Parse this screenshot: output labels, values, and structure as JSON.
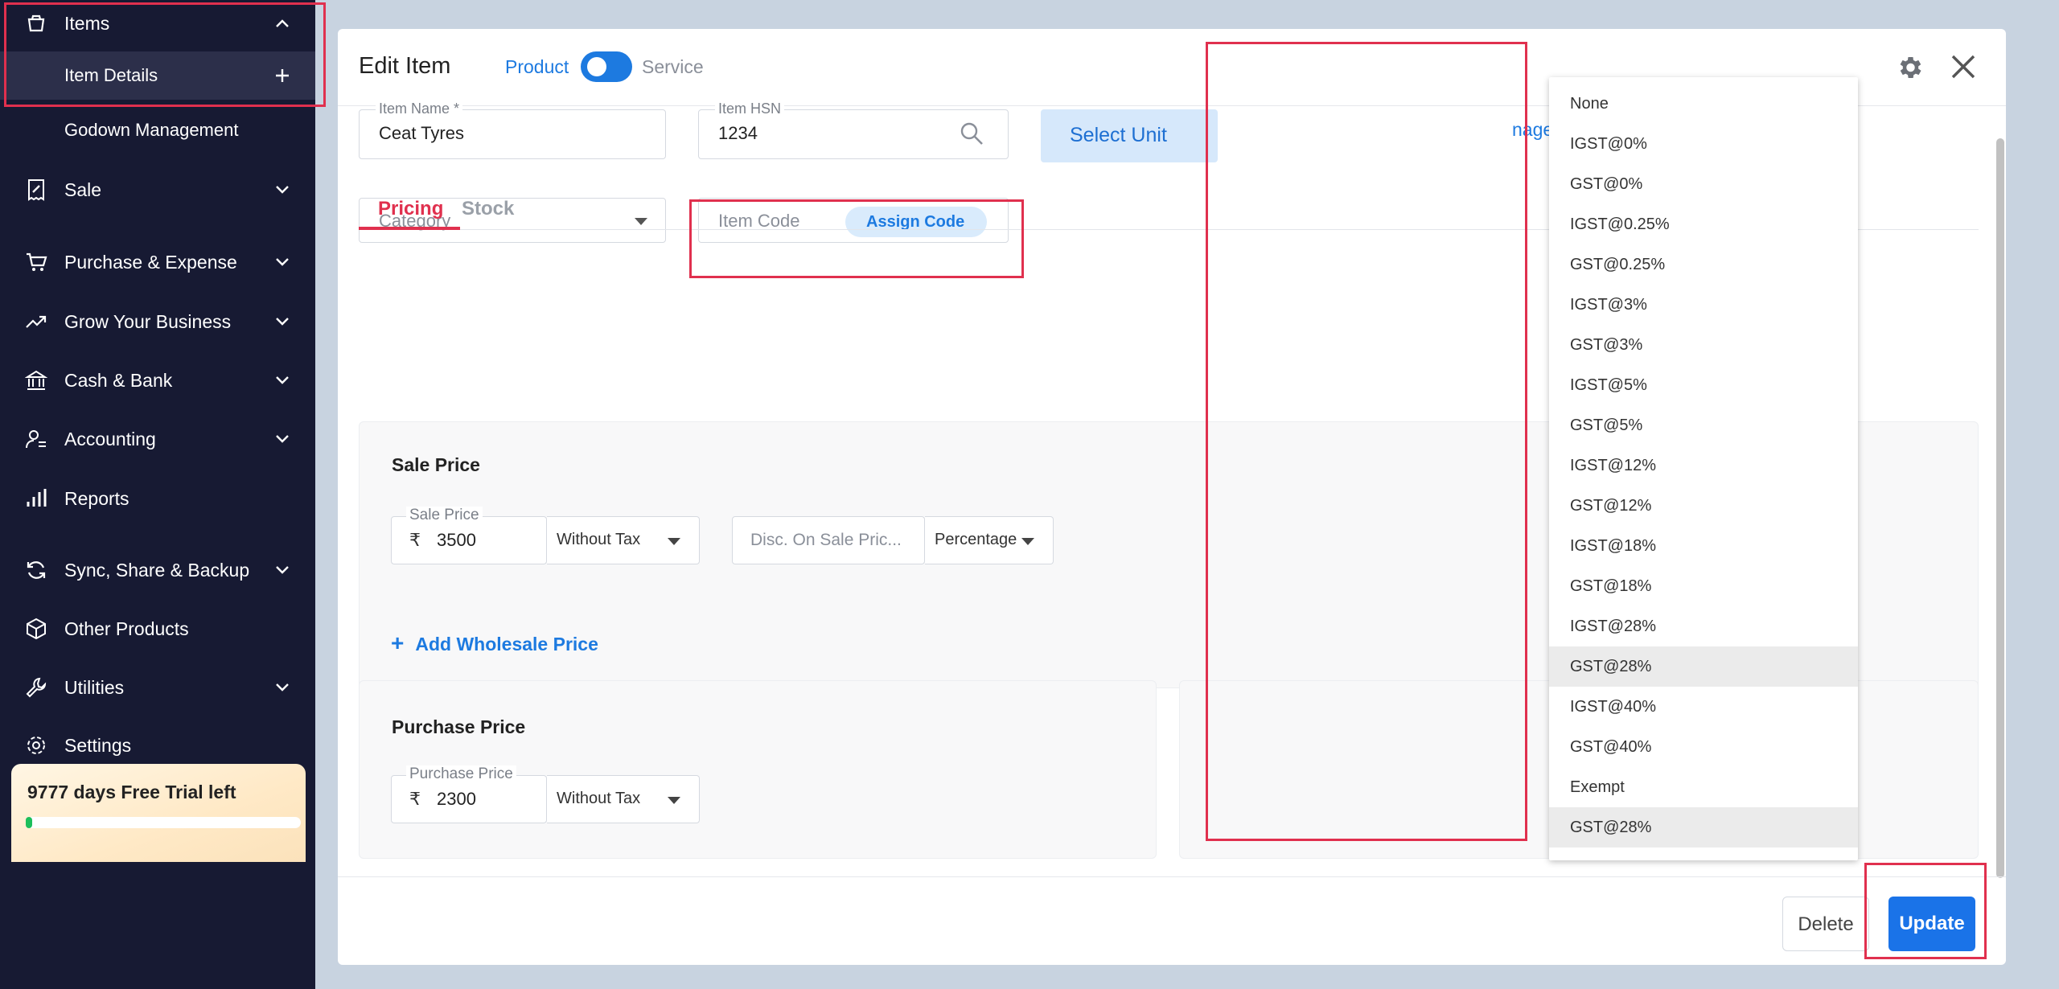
{
  "sidebar": {
    "items_label": "Items",
    "item_details": "Item Details",
    "godown": "Godown Management",
    "nav": [
      {
        "label": "Sale",
        "icon": "receipt-icon"
      },
      {
        "label": "Purchase & Expense",
        "icon": "cart-icon"
      },
      {
        "label": "Grow Your Business",
        "icon": "trending-icon"
      },
      {
        "label": "Cash & Bank",
        "icon": "bank-icon"
      },
      {
        "label": "Accounting",
        "icon": "user-ledger-icon"
      },
      {
        "label": "Reports",
        "icon": "bar-chart-icon"
      },
      {
        "label": "Sync, Share & Backup",
        "icon": "sync-icon"
      },
      {
        "label": "Other Products",
        "icon": "cube-icon"
      },
      {
        "label": "Utilities",
        "icon": "wrench-icon"
      },
      {
        "label": "Settings",
        "icon": "gear-icon"
      }
    ],
    "trial_text": "9777 days Free Trial left",
    "trial_progress": 0.01
  },
  "modal": {
    "title": "Edit Item",
    "toggle_product": "Product",
    "toggle_service": "Service",
    "item_name_label": "Item Name *",
    "item_name_value": "Ceat Tyres",
    "item_hsn_label": "Item HSN",
    "item_hsn_value": "1234",
    "select_unit": "Select Unit",
    "manage_link": "nage",
    "category_placeholder": "Category",
    "item_code_placeholder": "Item Code",
    "assign_code": "Assign Code",
    "tabs": [
      "Pricing",
      "Stock"
    ],
    "sale_price_title": "Sale Price",
    "sale_price_label": "Sale Price",
    "currency": "₹",
    "sale_price_value": "3500",
    "sale_tax_mode": "Without Tax",
    "discount_placeholder": "Disc. On Sale Pric...",
    "discount_type": "Percentage",
    "wholesale_plus": "+",
    "wholesale_link": "Add Wholesale Price",
    "purchase_price_title": "Purchase Price",
    "purchase_price_label": "Purchase Price",
    "purchase_price_value": "2300",
    "purchase_tax_mode": "Without Tax",
    "delete": "Delete",
    "update": "Update"
  },
  "tax_dropdown": {
    "options": [
      "None",
      "IGST@0%",
      "GST@0%",
      "IGST@0.25%",
      "GST@0.25%",
      "IGST@3%",
      "GST@3%",
      "IGST@5%",
      "GST@5%",
      "IGST@12%",
      "GST@12%",
      "IGST@18%",
      "GST@18%",
      "IGST@28%",
      "GST@28%",
      "IGST@40%",
      "GST@40%",
      "Exempt",
      "GST@28%"
    ],
    "highlighted": [
      14,
      18
    ]
  },
  "colors": {
    "accent": "#1d7ae0",
    "active_tab": "#e0304e",
    "sidebar_bg": "#171a33",
    "annotation": "#e0304e"
  }
}
